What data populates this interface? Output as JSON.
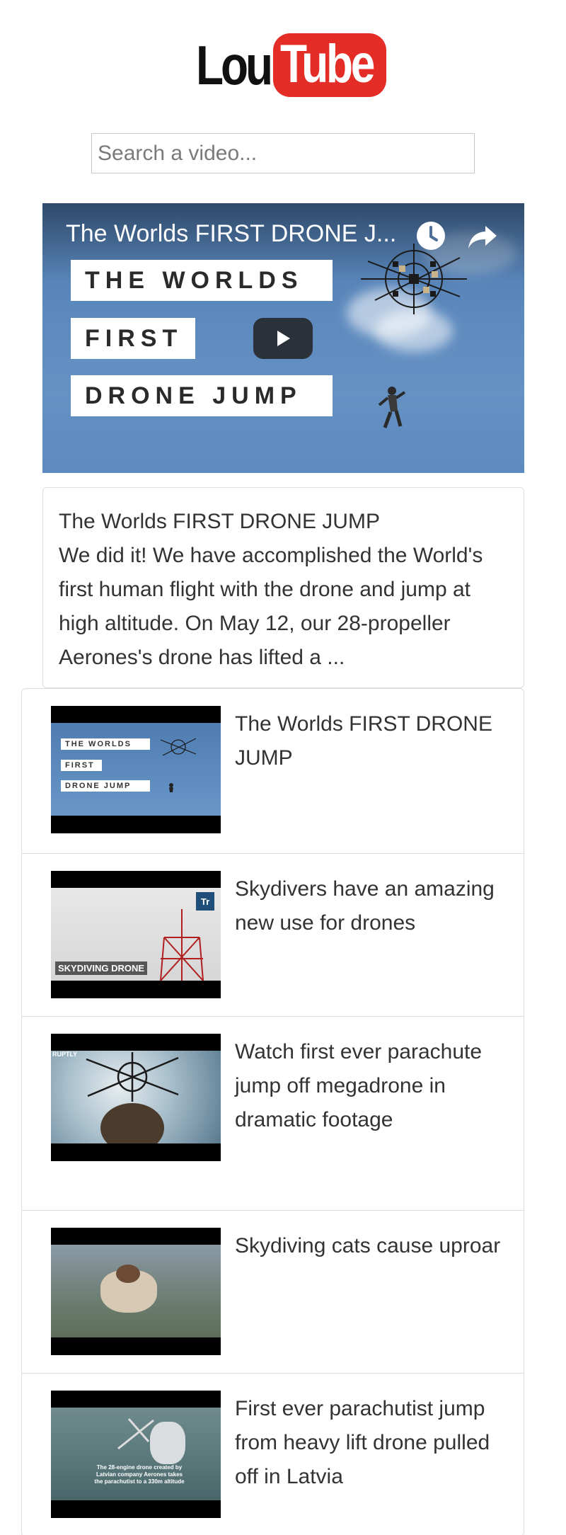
{
  "app": {
    "logo_part1": "Lou",
    "logo_part2": "Tube"
  },
  "search": {
    "placeholder": "Search a video...",
    "value": ""
  },
  "player": {
    "title": "The Worlds FIRST DRONE J...",
    "card_line1": "THE WORLDS",
    "card_line2": "FIRST",
    "card_line3": "DRONE JUMP"
  },
  "description": {
    "title": "The Worlds FIRST DRONE JUMP",
    "text": "We did it! We have accomplished the World's first human flight with the drone and jump at high altitude. On May 12, our 28-propeller Aerones's drone has lifted a ..."
  },
  "videos": [
    {
      "title": "The Worlds FIRST DRONE JUMP",
      "thumb_text1": "THE WORLDS",
      "thumb_text2": "FIRST",
      "thumb_text3": "DRONE JUMP"
    },
    {
      "title": "Skydivers have an amazing new use for drones",
      "thumb_text1": "SKYDIVING DRONE",
      "thumb_badge": "Tr"
    },
    {
      "title": "Watch first ever parachute jump off megadrone in dramatic footage",
      "thumb_text1": "RUPTLY"
    },
    {
      "title": "Skydiving cats cause uproar"
    },
    {
      "title": "First ever parachutist jump from heavy lift drone pulled off in Latvia",
      "thumb_text1": "The 28-engine drone created by",
      "thumb_text2": "Latvian company Aerones takes",
      "thumb_text3": "the parachutist to a 330m altitude"
    }
  ],
  "colors": {
    "brand_red": "#e52d27",
    "text": "#333333",
    "border": "#dddddd"
  }
}
